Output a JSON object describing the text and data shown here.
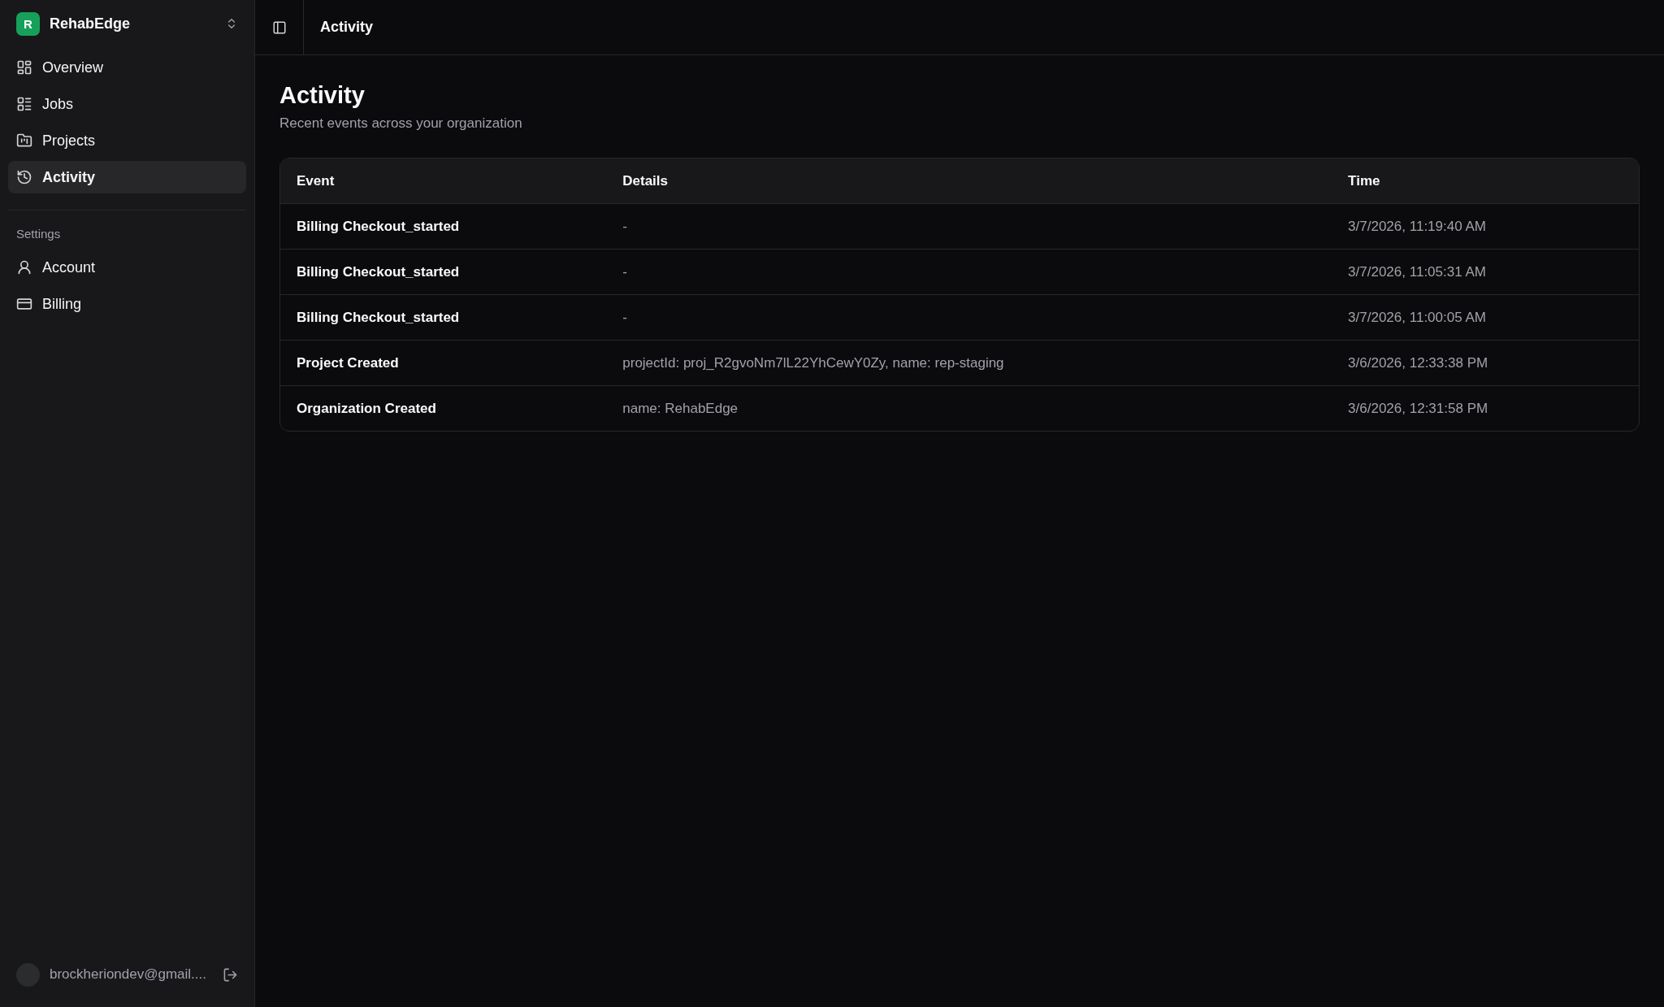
{
  "org": {
    "initial": "R",
    "name": "RehabEdge"
  },
  "nav": [
    {
      "label": "Overview",
      "selected": false
    },
    {
      "label": "Jobs",
      "selected": false
    },
    {
      "label": "Projects",
      "selected": false
    },
    {
      "label": "Activity",
      "selected": true
    }
  ],
  "settings": {
    "heading": "Settings",
    "items": [
      {
        "label": "Account",
        "selected": false
      },
      {
        "label": "Billing",
        "selected": false
      }
    ]
  },
  "user": {
    "email": "brockheriondev@gmail...."
  },
  "breadcrumb": "Activity",
  "page": {
    "title": "Activity",
    "subtitle": "Recent events across your organization"
  },
  "table": {
    "columns": [
      "Event",
      "Details",
      "Time"
    ],
    "rows": [
      [
        "Billing Checkout_started",
        "-",
        "3/7/2026, 11:19:40 AM"
      ],
      [
        "Billing Checkout_started",
        "-",
        "3/7/2026, 11:05:31 AM"
      ],
      [
        "Billing Checkout_started",
        "-",
        "3/7/2026, 11:00:05 AM"
      ],
      [
        "Project Created",
        "projectId: proj_R2gvoNm7lL22YhCewY0Zy, name: rep-staging",
        "3/6/2026, 12:33:38 PM"
      ],
      [
        "Organization Created",
        "name: RehabEdge",
        "3/6/2026, 12:31:58 PM"
      ]
    ]
  }
}
